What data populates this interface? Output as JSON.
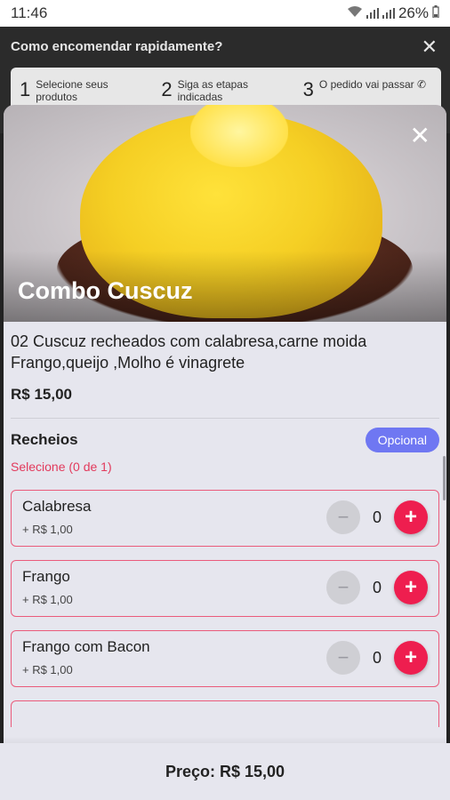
{
  "status_bar": {
    "time": "11:46",
    "battery": "26%"
  },
  "help": {
    "title": "Como encomendar rapidamente?",
    "steps": [
      {
        "num": "1",
        "text": "Selecione seus produtos"
      },
      {
        "num": "2",
        "text": "Siga as etapas indicadas"
      },
      {
        "num": "3",
        "text": "O pedido vai passar"
      }
    ]
  },
  "product": {
    "title": "Combo Cuscuz",
    "description_line1": "02 Cuscuz recheados com calabresa,carne moida",
    "description_line2": "Frango,queijo ,Molho é vinagrete",
    "price": "R$ 15,00"
  },
  "group": {
    "title": "Recheios",
    "badge": "Opcional",
    "hint": "Selecione (0 de 1)"
  },
  "options": [
    {
      "name": "Calabresa",
      "price": "+ R$ 1,00",
      "qty": "0"
    },
    {
      "name": "Frango",
      "price": "+ R$ 1,00",
      "qty": "0"
    },
    {
      "name": "Frango com Bacon",
      "price": "+ R$ 1,00",
      "qty": "0"
    }
  ],
  "footer": {
    "label": "Preço: R$ 15,00"
  },
  "icons": {
    "close": "close-icon",
    "minus": "minus-icon",
    "plus": "plus-icon",
    "whatsapp": "whatsapp-icon"
  },
  "colors": {
    "accent": "#ee1e4f",
    "badge": "#6f77f2",
    "hint": "#e23a5c",
    "option_border": "#ea5b7b"
  }
}
